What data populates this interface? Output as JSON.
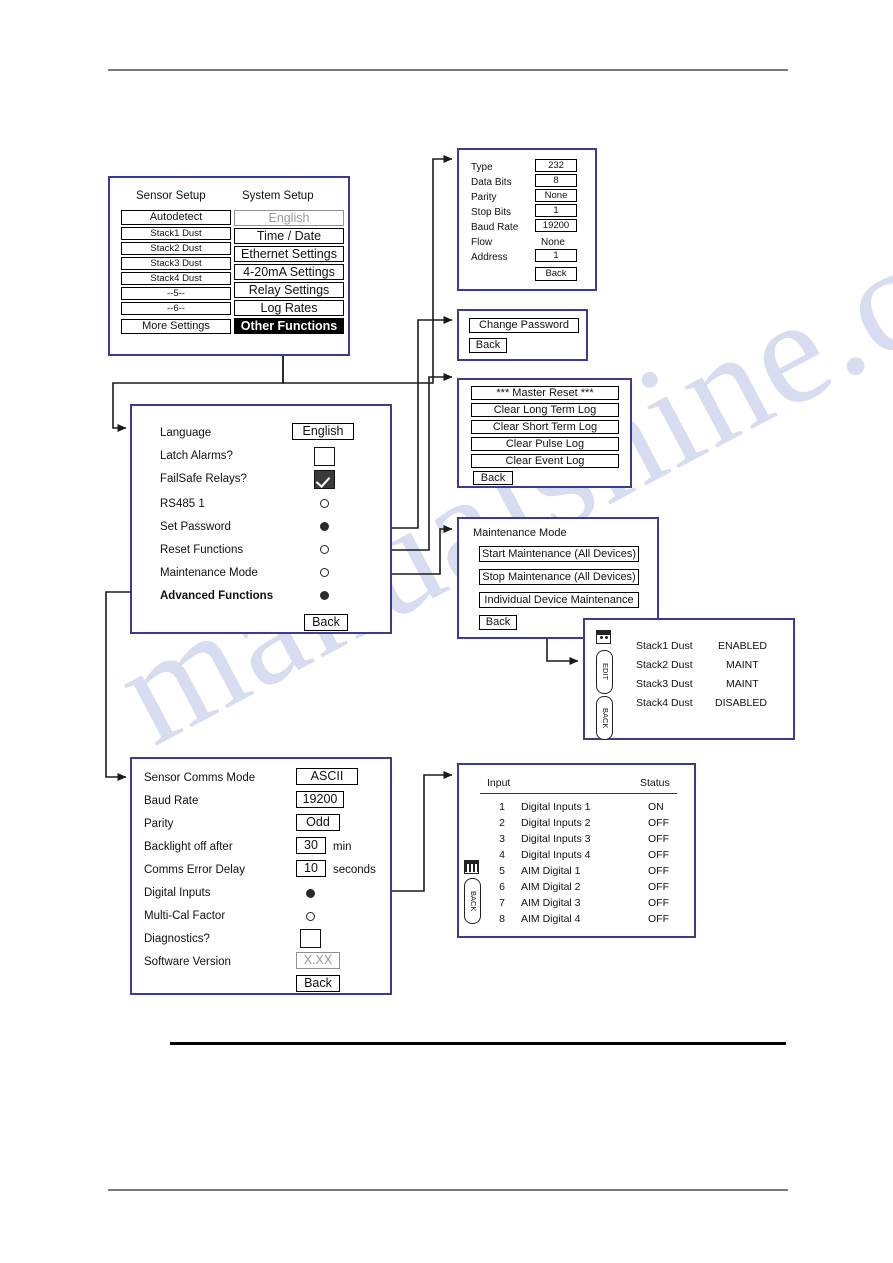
{
  "document": {
    "watermark_text": "manualshine.com"
  },
  "menu_panel": {
    "col_left_title": "Sensor Setup",
    "col_right_title": "System Setup",
    "left_items": [
      {
        "label": "Autodetect",
        "style": "normal"
      },
      {
        "label": "Stack1 Dust",
        "style": "small"
      },
      {
        "label": "Stack2 Dust",
        "style": "small"
      },
      {
        "label": "Stack3 Dust",
        "style": "small"
      },
      {
        "label": "Stack4 Dust",
        "style": "small"
      },
      {
        "label": "--5--",
        "style": "small"
      },
      {
        "label": "--6--",
        "style": "small"
      },
      {
        "label": "More Settings",
        "style": "normal"
      }
    ],
    "right_items": [
      {
        "label": "English",
        "style": "disabled"
      },
      {
        "label": "Time / Date",
        "style": "normal"
      },
      {
        "label": "Ethernet Settings",
        "style": "normal"
      },
      {
        "label": "4-20mA Settings",
        "style": "normal"
      },
      {
        "label": "Relay Settings",
        "style": "normal"
      },
      {
        "label": "Log Rates",
        "style": "normal"
      },
      {
        "label": "Other Functions",
        "style": "selected"
      }
    ]
  },
  "serial_panel": {
    "rows": [
      {
        "label": "Type",
        "value": "232",
        "boxed": true
      },
      {
        "label": "Data Bits",
        "value": "8",
        "boxed": true
      },
      {
        "label": "Parity",
        "value": "None",
        "boxed": true
      },
      {
        "label": "Stop Bits",
        "value": "1",
        "boxed": true
      },
      {
        "label": "Baud Rate",
        "value": "19200",
        "boxed": true
      },
      {
        "label": "Flow",
        "value": "None",
        "boxed": false
      },
      {
        "label": "Address",
        "value": "1",
        "boxed": true
      }
    ],
    "back_label": "Back"
  },
  "password_panel": {
    "change_password_label": "Change Password",
    "back_label": "Back"
  },
  "reset_panel": {
    "items": [
      "*** Master Reset ***",
      "Clear Long Term Log",
      "Clear Short Term Log",
      "Clear Pulse Log",
      "Clear Event Log"
    ],
    "back_label": "Back"
  },
  "maintenance_panel": {
    "title": "Maintenance Mode",
    "items": [
      "Start Maintenance (All Devices)",
      "Stop Maintenance (All Devices)",
      "Individual Device Maintenance"
    ],
    "back_label": "Back"
  },
  "device_status_panel": {
    "softkeys": [
      "EDIT",
      "BACK"
    ],
    "rows": [
      {
        "name": "Stack1 Dust",
        "status": "ENABLED"
      },
      {
        "name": "Stack2 Dust",
        "status": "MAINT"
      },
      {
        "name": "Stack3 Dust",
        "status": "MAINT"
      },
      {
        "name": "Stack4 Dust",
        "status": "DISABLED"
      }
    ]
  },
  "advanced_panel": {
    "rows": [
      {
        "label": "Language",
        "widget": "value",
        "value": "English",
        "bold": false
      },
      {
        "label": "Latch Alarms?",
        "widget": "checkbox",
        "checked": false,
        "bold": false
      },
      {
        "label": "FailSafe Relays?",
        "widget": "checkbox",
        "checked": true,
        "bold": false
      },
      {
        "label": "RS485 1",
        "widget": "radio",
        "checked": false,
        "bold": false
      },
      {
        "label": "Set Password",
        "widget": "radio",
        "checked": true,
        "bold": false
      },
      {
        "label": "Reset Functions",
        "widget": "radio",
        "checked": false,
        "bold": false
      },
      {
        "label": "Maintenance Mode",
        "widget": "radio",
        "checked": false,
        "bold": false
      },
      {
        "label": "Advanced Functions",
        "widget": "radio",
        "checked": true,
        "bold": true
      }
    ],
    "back_label": "Back"
  },
  "comms_panel": {
    "rows": [
      {
        "label": "Sensor Comms Mode",
        "widget": "value",
        "value": "ASCII",
        "unit": ""
      },
      {
        "label": "Baud Rate",
        "widget": "value",
        "value": "19200",
        "unit": ""
      },
      {
        "label": "Parity",
        "widget": "value",
        "value": "Odd",
        "unit": ""
      },
      {
        "label": "Backlight off after",
        "widget": "value",
        "value": "30",
        "unit": "min"
      },
      {
        "label": "Comms Error Delay",
        "widget": "value",
        "value": "10",
        "unit": "seconds"
      },
      {
        "label": "Digital Inputs",
        "widget": "radio",
        "checked": true,
        "unit": ""
      },
      {
        "label": "Multi-Cal Factor",
        "widget": "radio",
        "checked": false,
        "unit": ""
      },
      {
        "label": "Diagnostics?",
        "widget": "checkbox",
        "checked": false,
        "unit": ""
      },
      {
        "label": "Software Version",
        "widget": "value-grey",
        "value": "X.XX",
        "unit": ""
      }
    ],
    "back_label": "Back"
  },
  "inputs_panel": {
    "headers": {
      "input": "Input",
      "status": "Status"
    },
    "softkeys": [
      "BACK"
    ],
    "rows": [
      {
        "num": "1",
        "name": "Digital Inputs 1",
        "status": "ON"
      },
      {
        "num": "2",
        "name": "Digital Inputs 2",
        "status": "OFF"
      },
      {
        "num": "3",
        "name": "Digital Inputs 3",
        "status": "OFF"
      },
      {
        "num": "4",
        "name": "Digital Inputs 4",
        "status": "OFF"
      },
      {
        "num": "5",
        "name": "AIM Digital 1",
        "status": "OFF"
      },
      {
        "num": "6",
        "name": "AIM Digital 2",
        "status": "OFF"
      },
      {
        "num": "7",
        "name": "AIM Digital 3",
        "status": "OFF"
      },
      {
        "num": "8",
        "name": "AIM Digital 4",
        "status": "OFF"
      }
    ]
  },
  "colors": {
    "panel_border": "#3b3b8f",
    "selected_bg": "#000000",
    "disabled_text": "#9a9a9a",
    "watermark": "#b9c0e6"
  }
}
